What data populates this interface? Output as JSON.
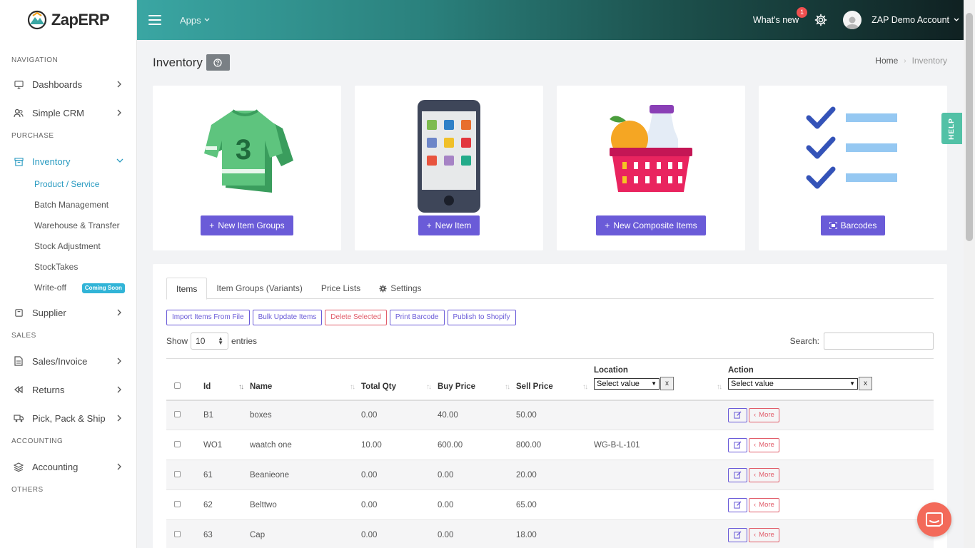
{
  "brand": {
    "name": "ZapERP"
  },
  "sidebar": {
    "sections": {
      "navigation": "NAVIGATION",
      "purchase": "PURCHASE",
      "sales": "SALES",
      "accounting": "ACCOUNTING",
      "others": "OTHERS"
    },
    "items": {
      "dashboards": "Dashboards",
      "crm": "Simple CRM",
      "inventory": "Inventory",
      "supplier": "Supplier",
      "sales_invoice": "Sales/Invoice",
      "returns": "Returns",
      "pick_pack": "Pick, Pack & Ship",
      "accounting": "Accounting"
    },
    "inventory_sub": {
      "product": "Product / Service",
      "batch": "Batch Management",
      "warehouse": "Warehouse & Transfer",
      "stock_adj": "Stock Adjustment",
      "stocktakes": "StockTakes",
      "writeoff": "Write-off",
      "coming_soon": "Coming Soon"
    },
    "accent_color": "#2a9bc1"
  },
  "header": {
    "apps": "Apps",
    "whats_new": "What's new",
    "whats_new_count": "1",
    "account": "ZAP Demo Account"
  },
  "page": {
    "title": "Inventory",
    "breadcrumb": {
      "home": "Home",
      "current": "Inventory"
    }
  },
  "cards": {
    "item_groups": "New Item Groups",
    "item": "New Item",
    "composite": "New Composite Items",
    "barcodes": "Barcodes",
    "button_color": "#6a5bd8"
  },
  "tabs": {
    "items": "Items",
    "groups": "Item Groups (Variants)",
    "price_lists": "Price Lists",
    "settings": "Settings"
  },
  "actions": {
    "import": "Import Items From File",
    "bulk": "Bulk Update Items",
    "delete": "Delete Selected",
    "print": "Print Barcode",
    "shopify": "Publish to Shopify"
  },
  "list_controls": {
    "show": "Show",
    "entries_value": "10",
    "entries": "entries",
    "search": "Search:"
  },
  "table": {
    "headers": {
      "id": "Id",
      "name": "Name",
      "qty": "Total Qty",
      "buy": "Buy Price",
      "sell": "Sell Price",
      "location": "Location",
      "action": "Action"
    },
    "filter_placeholder": "Select value",
    "clear": "x",
    "more": "More",
    "rows": [
      {
        "id": "B1",
        "name": "boxes",
        "qty": "0.00",
        "buy": "40.00",
        "sell": "50.00",
        "location": ""
      },
      {
        "id": "WO1",
        "name": "waatch one",
        "qty": "10.00",
        "buy": "600.00",
        "sell": "800.00",
        "location": "WG-B-L-101"
      },
      {
        "id": "61",
        "name": "Beanieone",
        "qty": "0.00",
        "buy": "0.00",
        "sell": "20.00",
        "location": ""
      },
      {
        "id": "62",
        "name": "Belttwo",
        "qty": "0.00",
        "buy": "0.00",
        "sell": "65.00",
        "location": ""
      },
      {
        "id": "63",
        "name": "Cap",
        "qty": "0.00",
        "buy": "0.00",
        "sell": "18.00",
        "location": ""
      }
    ]
  },
  "help_tab": "HELP"
}
